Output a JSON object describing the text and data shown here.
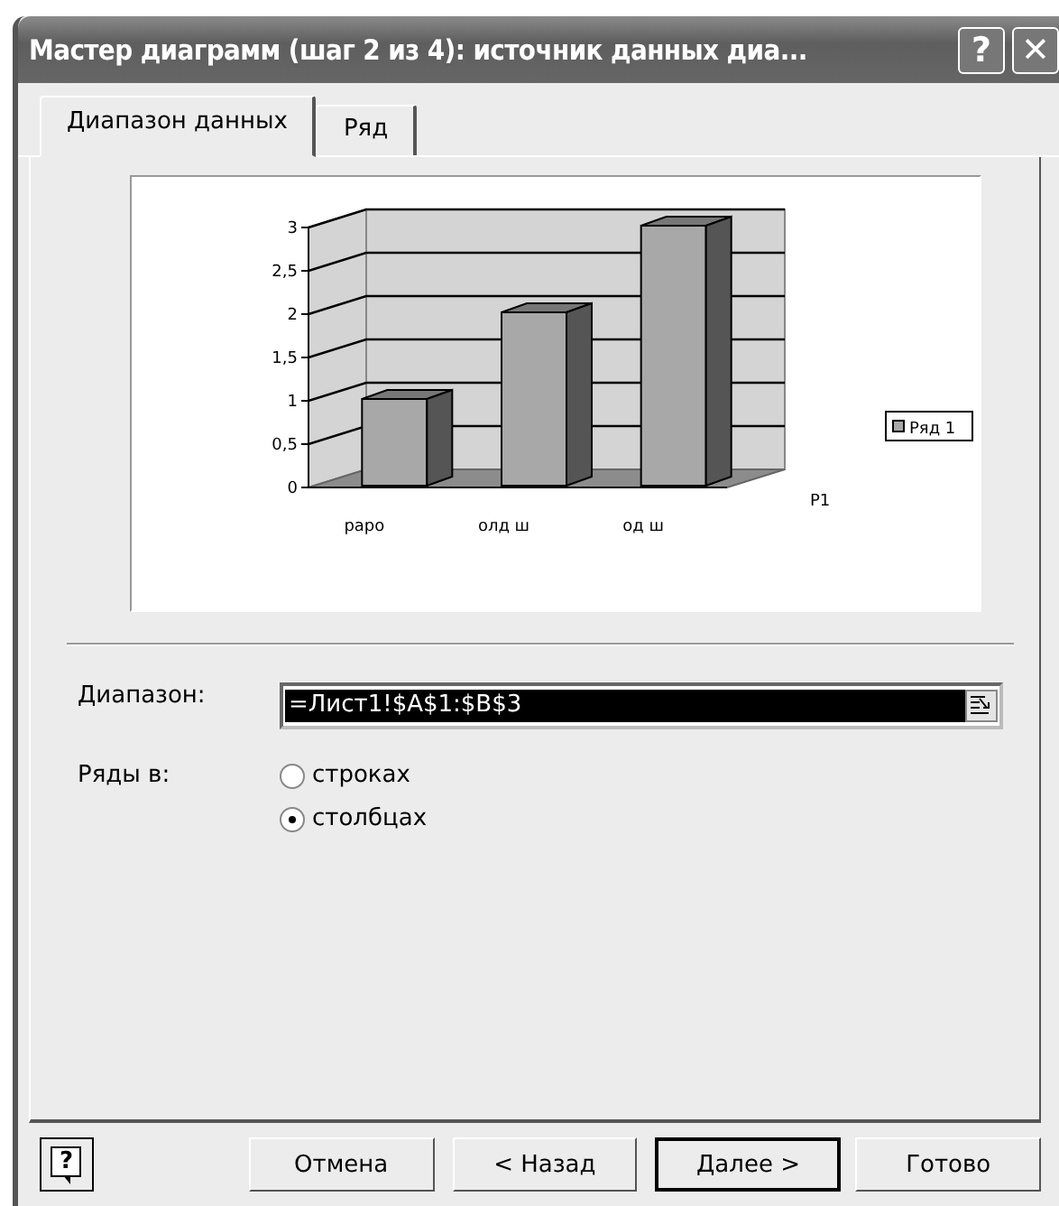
{
  "window": {
    "title": "Мастер диаграмм (шаг 2 из 4): источник данных диа...",
    "help_glyph": "?",
    "close_glyph": "✕"
  },
  "tabs": [
    {
      "label": "Диапазон данных",
      "selected": true
    },
    {
      "label": "Ряд",
      "selected": false
    }
  ],
  "preview": {
    "chart_data": {
      "type": "bar",
      "categories": [
        "раро",
        "олд ш",
        "од ш"
      ],
      "series": [
        {
          "name": "Ряд 1",
          "color": "#a8a8a8",
          "values": [
            1,
            2,
            3
          ]
        }
      ],
      "ylim": [
        0,
        3
      ],
      "yticks": [
        0,
        {
          "value": 0.5,
          "label": "0,5"
        },
        1,
        {
          "value": 1.5,
          "label": "1,5"
        },
        2,
        {
          "value": 2.5,
          "label": "2,5"
        },
        3
      ]
    },
    "series_axis_label": "Р1"
  },
  "range": {
    "label": "Диапазон:",
    "value": "=Лист1!$A$1:$B$3"
  },
  "series_in": {
    "label": "Ряды в:",
    "options": [
      {
        "label": "строках",
        "selected": false
      },
      {
        "label": "столбцах",
        "selected": true
      }
    ]
  },
  "help_button": {
    "glyph": "?"
  },
  "buttons": [
    {
      "label": "Отмена",
      "default": false
    },
    {
      "label": "< Назад",
      "default": false
    },
    {
      "label": "Далее >",
      "default": true
    },
    {
      "label": "Готово",
      "default": false
    }
  ]
}
